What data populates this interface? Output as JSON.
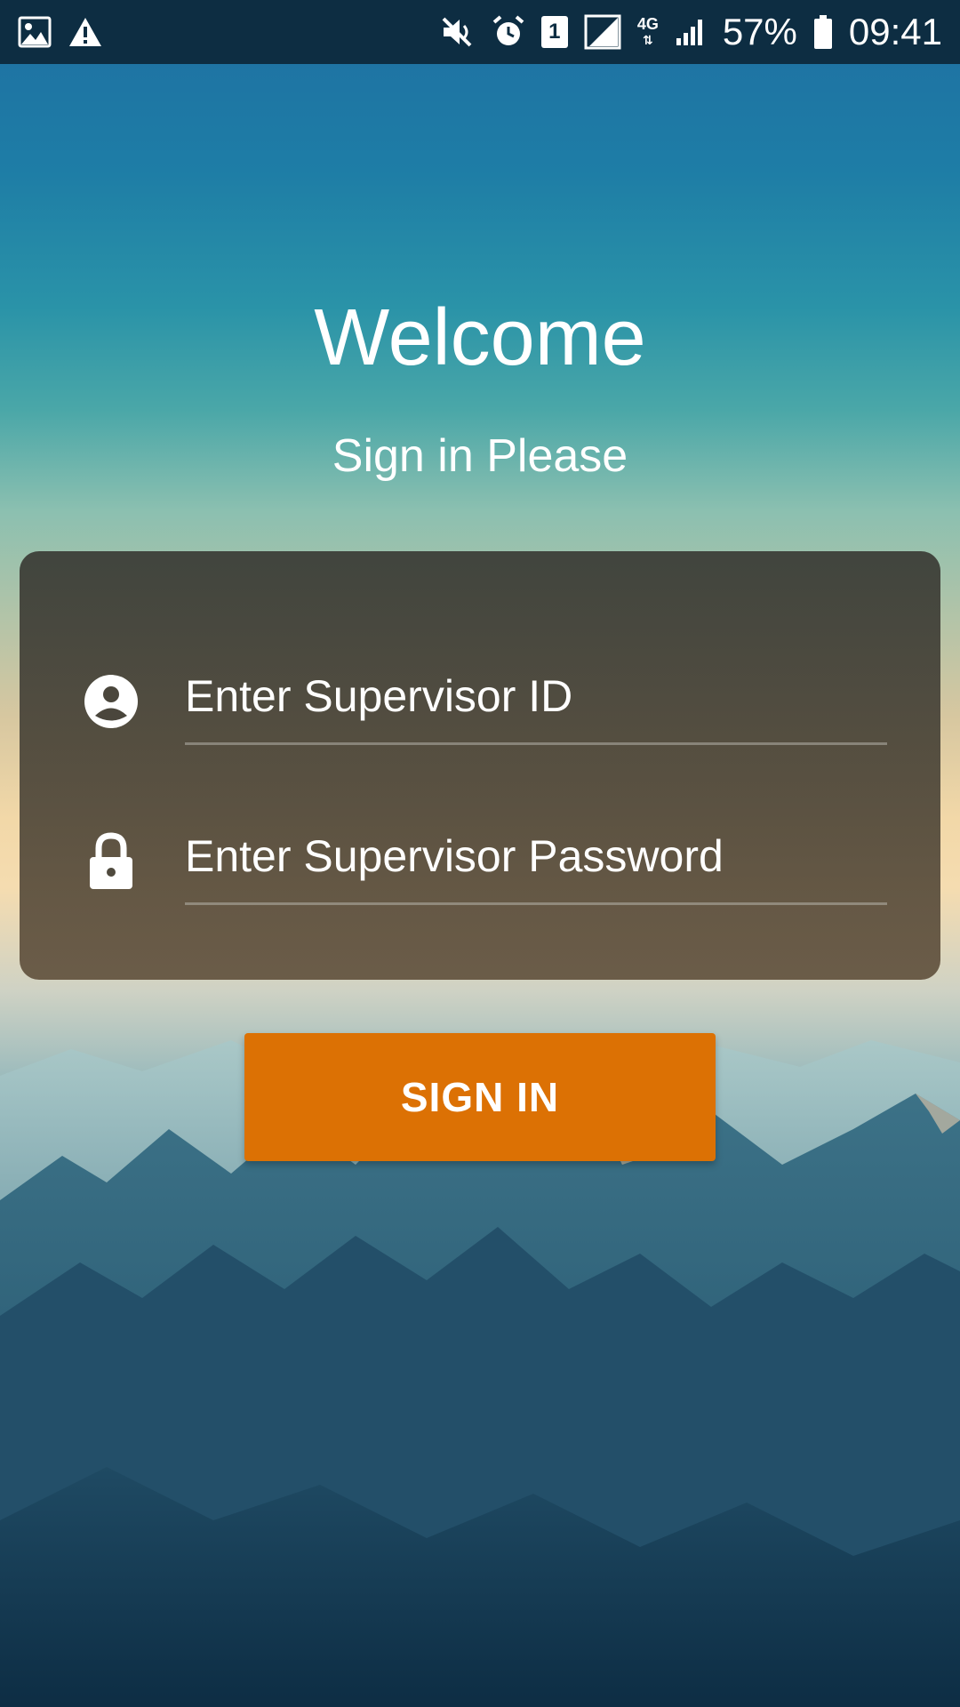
{
  "status_bar": {
    "left_icons": [
      "image-icon",
      "warning-icon"
    ],
    "right_icons": [
      "mute-icon",
      "alarm-icon",
      "sim-1-icon",
      "no-signal-icon",
      "data-4g-icon",
      "signal-icon",
      "battery-icon"
    ],
    "sim_number": "1",
    "network_type": "4G",
    "battery_percent": "57%",
    "time": "09:41"
  },
  "header": {
    "title": "Welcome",
    "subtitle": "Sign in Please"
  },
  "login_form": {
    "supervisor_id": {
      "icon": "account-circle-icon",
      "placeholder": "Enter Supervisor ID",
      "value": ""
    },
    "supervisor_password": {
      "icon": "lock-icon",
      "placeholder": "Enter Supervisor Password",
      "value": ""
    },
    "submit_label": "SIGN IN"
  },
  "colors": {
    "accent": "#dc7104",
    "status_bar_bg": "#0d2d42",
    "card_bg": "#4a463c",
    "text": "#ffffff"
  }
}
